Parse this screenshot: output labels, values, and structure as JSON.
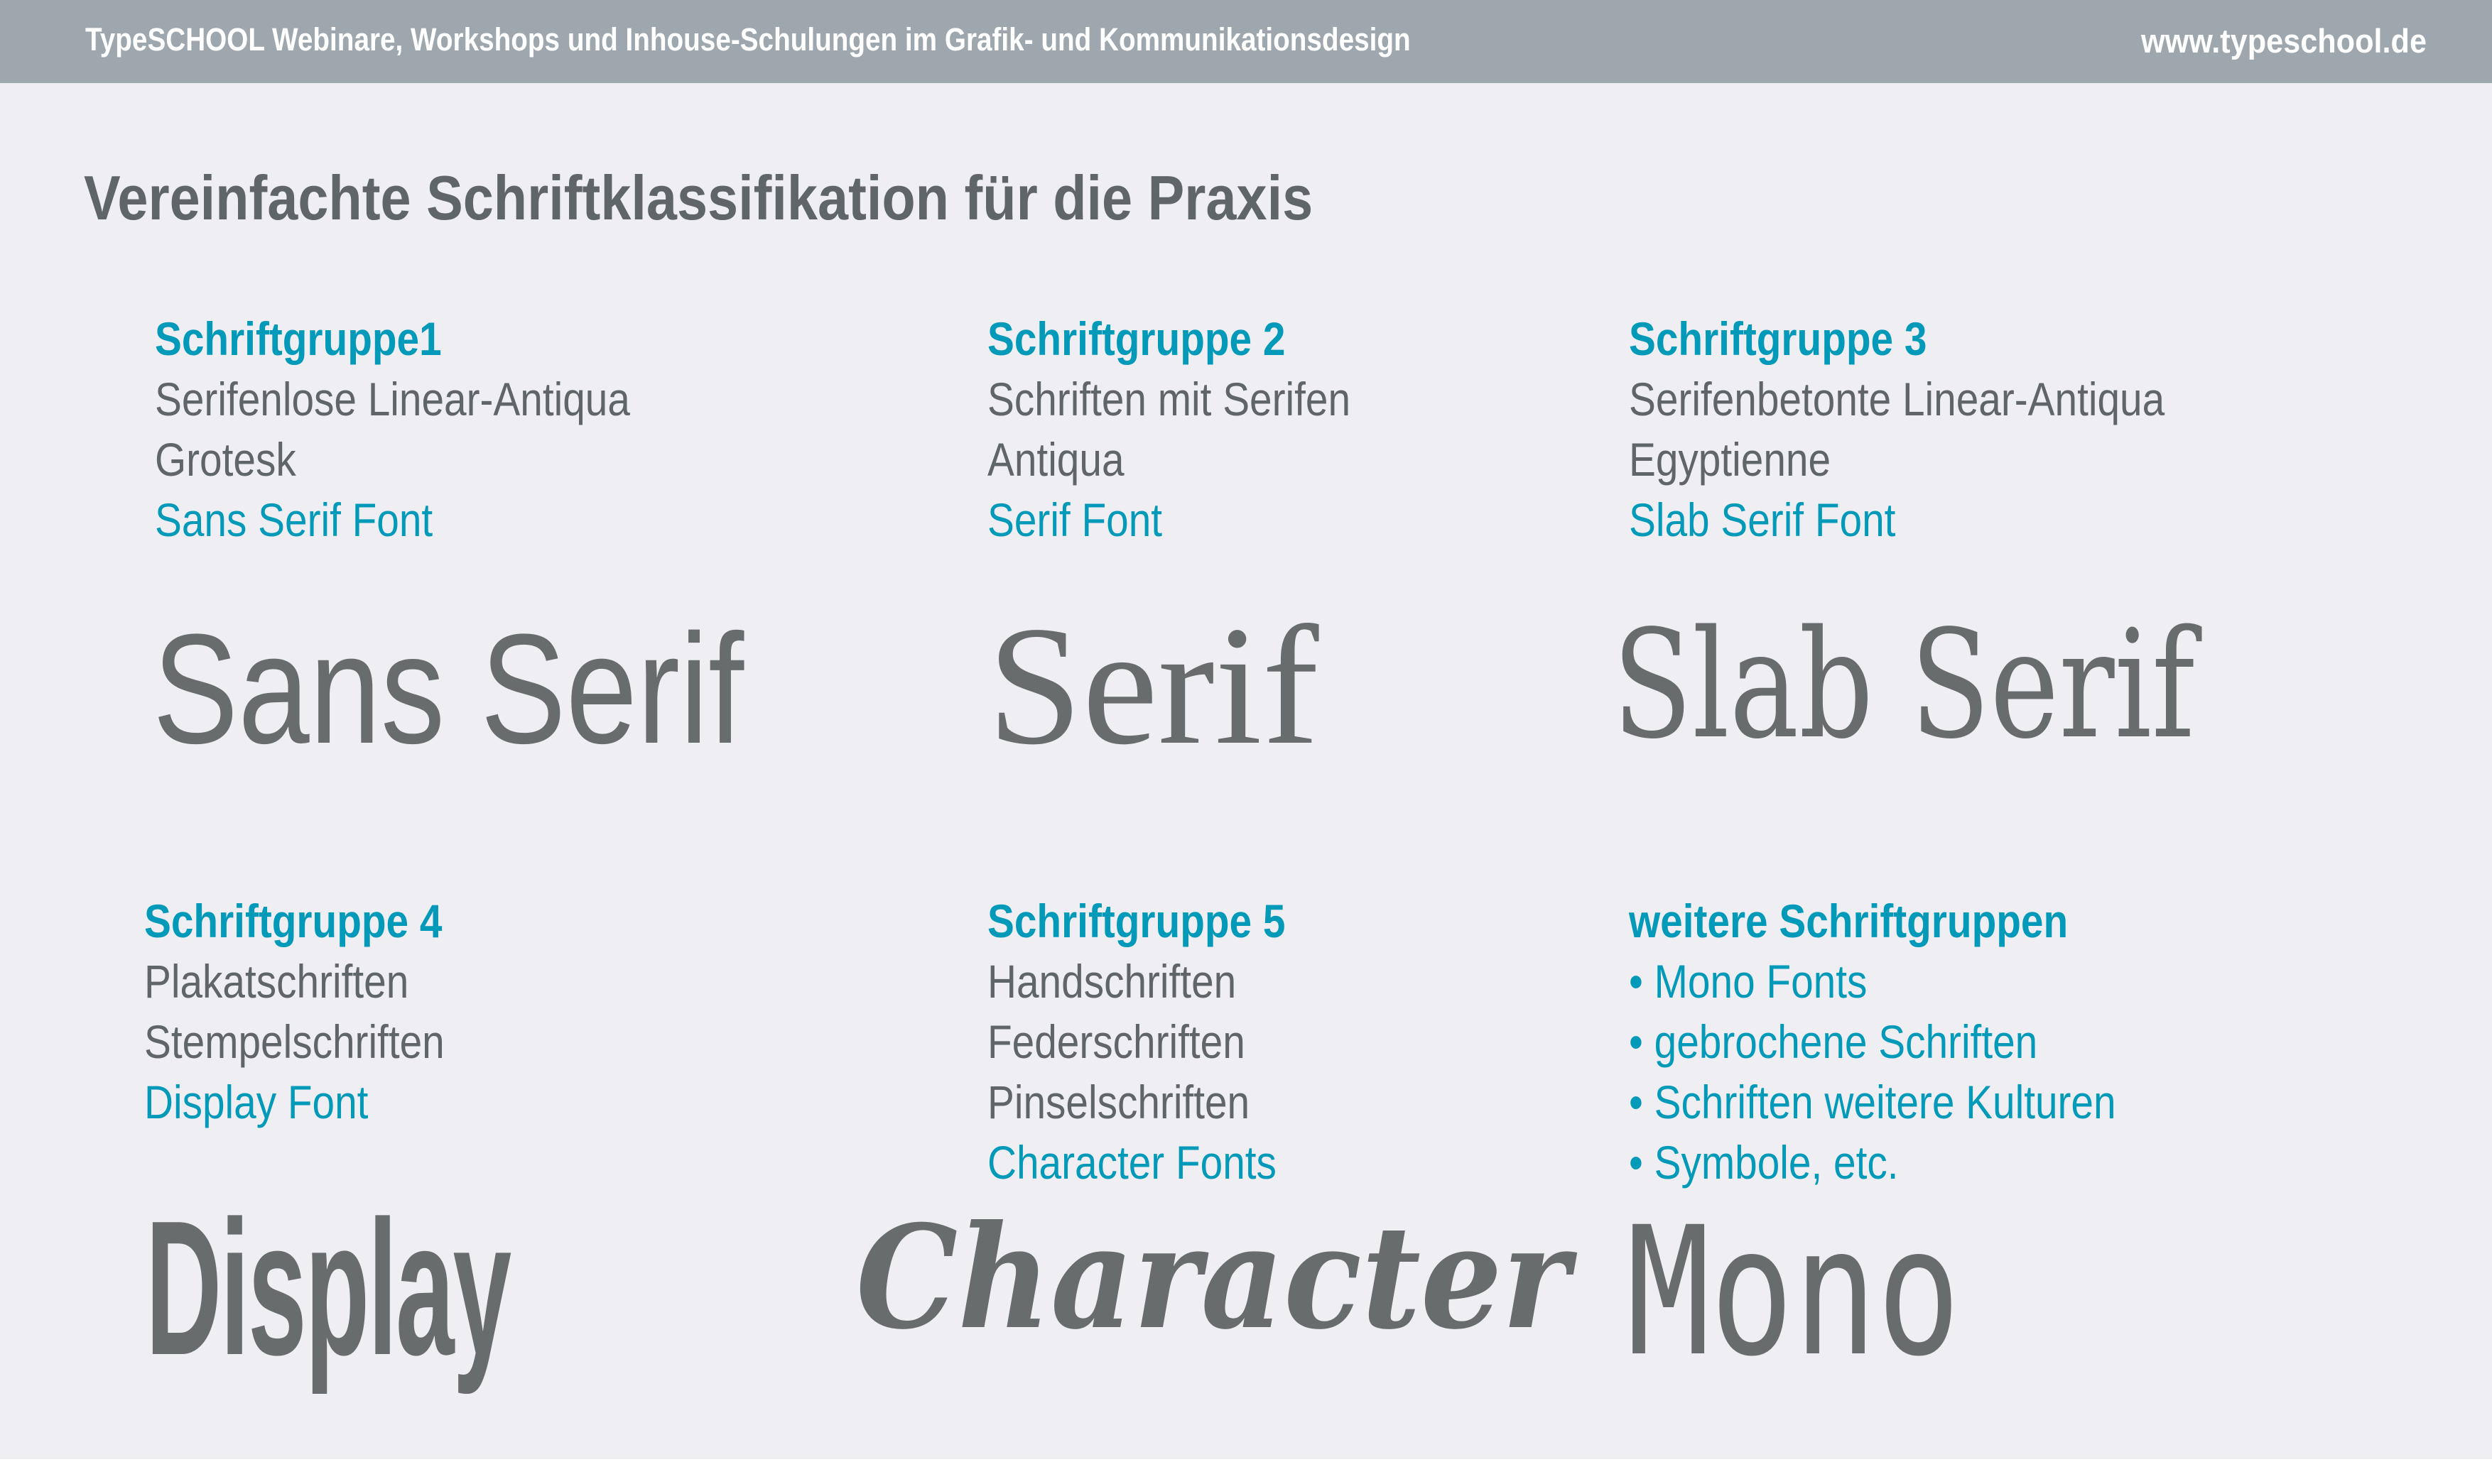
{
  "header": {
    "tagline": "TypeSCHOOL Webinare, Workshops und Inhouse-Schulungen im Grafik- und Kommunikationsdesign",
    "website": "www.typeschool.de"
  },
  "title": "Vereinfachte Schriftklassifikation für die Praxis",
  "colors": {
    "accent": "#0399b8",
    "text": "#5f6568",
    "specimen": "#686c6d",
    "header_bar": "#9ea7ad",
    "background": "#efeef3"
  },
  "groups": [
    {
      "heading": "Schriftgruppe1",
      "descriptions": [
        "Serifenlose Linear-Antiqua",
        "Grotesk"
      ],
      "english": "Sans Serif Font",
      "specimen": "Sans Serif"
    },
    {
      "heading": "Schriftgruppe 2",
      "descriptions": [
        "Schriften mit Serifen",
        "Antiqua"
      ],
      "english": "Serif Font",
      "specimen": "Serif"
    },
    {
      "heading": "Schriftgruppe 3",
      "descriptions": [
        "Serifenbetonte Linear-Antiqua",
        "Egyptienne"
      ],
      "english": "Slab Serif Font",
      "specimen": "Slab Serif"
    },
    {
      "heading": "Schriftgruppe 4",
      "descriptions": [
        "Plakatschriften",
        "Stempelschriften"
      ],
      "english": "Display Font",
      "specimen": "Display"
    },
    {
      "heading": "Schriftgruppe 5",
      "descriptions": [
        "Handschriften",
        "Federschriften",
        "Pinselschriften"
      ],
      "english": "Character Fonts",
      "specimen": "Character"
    },
    {
      "heading": "weitere Schriftgruppen",
      "bullets": [
        "Mono Fonts",
        "gebrochene Schriften",
        "Schriften weitere Kulturen",
        "Symbole, etc."
      ],
      "specimen": "Mono"
    }
  ]
}
